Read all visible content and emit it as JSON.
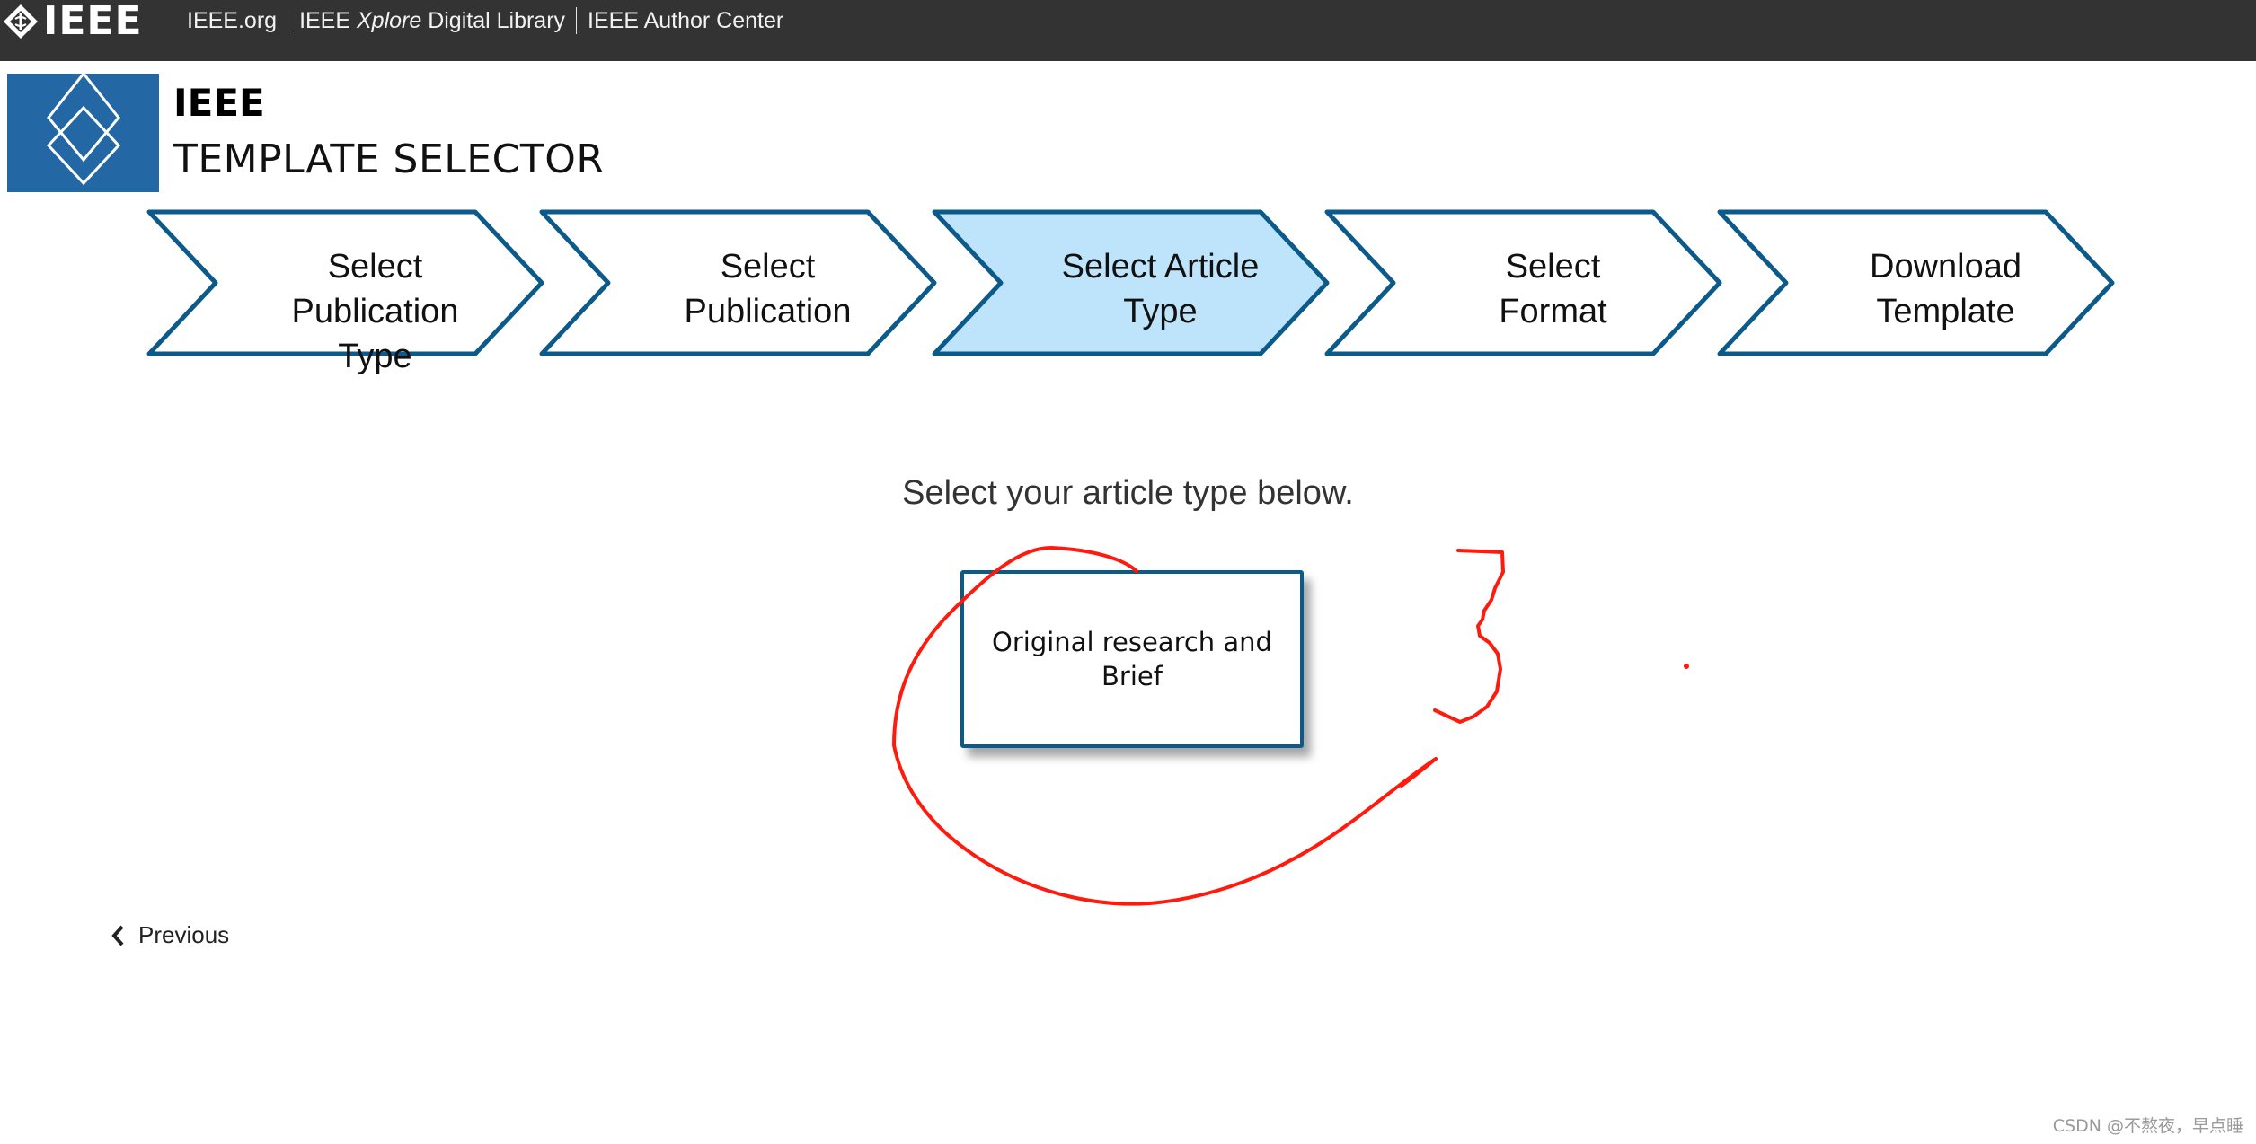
{
  "topbar": {
    "logo_text": "IEEE",
    "links": [
      {
        "label": "IEEE.org"
      },
      {
        "label_prefix": "IEEE ",
        "label_italic": "Xplore",
        "label_suffix": " Digital Library"
      },
      {
        "label": "IEEE Author Center"
      }
    ]
  },
  "brand": {
    "name": "IEEE",
    "title": "TEMPLATE SELECTOR",
    "color": "#2467a5"
  },
  "steps": [
    {
      "label_lines": [
        "Select",
        "Publication",
        "Type"
      ],
      "active": false
    },
    {
      "label_lines": [
        "Select",
        "Publication"
      ],
      "active": false
    },
    {
      "label_lines": [
        "Select Article",
        "Type"
      ],
      "active": true
    },
    {
      "label_lines": [
        "Select",
        "Format"
      ],
      "active": false
    },
    {
      "label_lines": [
        "Download",
        "Template"
      ],
      "active": false
    }
  ],
  "step_colors": {
    "border": "#0b5a8a",
    "active_fill": "#bde4fb",
    "inactive_fill": "#ffffff"
  },
  "main": {
    "prompt": "Select your article type below.",
    "options": [
      {
        "label": "Original research and Brief"
      }
    ]
  },
  "nav": {
    "previous_label": "Previous",
    "previous_icon": "chevron-left-icon"
  },
  "annotation": {
    "color": "#ff1a0e",
    "digit": "3"
  },
  "watermark": "CSDN @不熬夜，早点睡"
}
